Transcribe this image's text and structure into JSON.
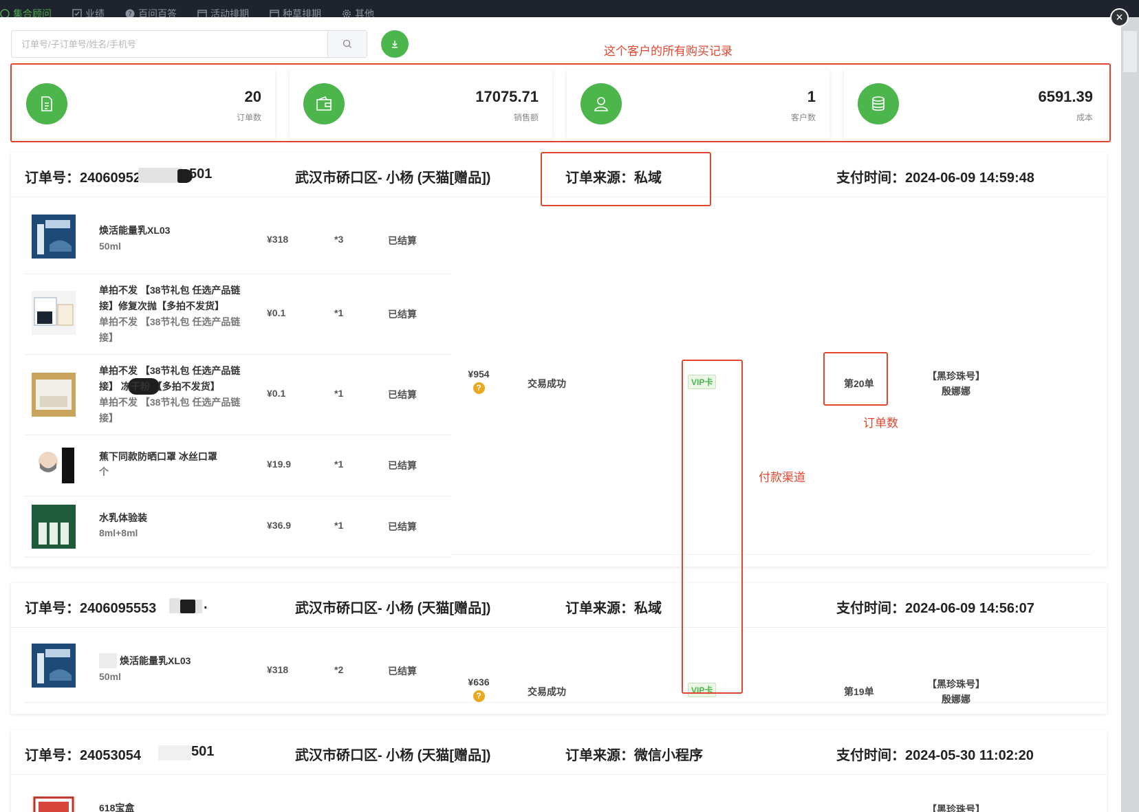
{
  "topnav": {
    "items": [
      {
        "label": "集合顾问",
        "icon": "chat-icon",
        "active": true
      },
      {
        "label": "业绩",
        "icon": "checkbox-icon",
        "active": false
      },
      {
        "label": "百问百答",
        "icon": "question-icon",
        "active": false
      },
      {
        "label": "活动排期",
        "icon": "calendar-icon",
        "active": false
      },
      {
        "label": "种草排期",
        "icon": "calendar-icon",
        "active": false
      },
      {
        "label": "其他",
        "icon": "gear-icon",
        "active": false
      }
    ]
  },
  "search": {
    "placeholder": "订单号/子订单号/姓名/手机号",
    "value": ""
  },
  "annotations": {
    "all_records": "这个客户的所有购买记录",
    "order_count": "订单数",
    "payment_channel": "付款渠道"
  },
  "stats": [
    {
      "value": "20",
      "label": "订单数",
      "icon": "document-icon"
    },
    {
      "value": "17075.71",
      "label": "销售额",
      "icon": "wallet-icon"
    },
    {
      "value": "1",
      "label": "客户数",
      "icon": "user-icon"
    },
    {
      "value": "6591.39",
      "label": "成本",
      "icon": "database-icon"
    }
  ],
  "orders": [
    {
      "order_no": "订单号：24060952",
      "order_no_tail": "501",
      "address": "武汉市硚口区- 小杨 (天猫[赠品])",
      "source": "订单来源：私域",
      "pay_time": "支付时间：2024-06-09 14:59:48",
      "total": "¥954",
      "status": "交易成功",
      "pay_channel": "VIP卡",
      "sequence": "第20单",
      "staff_line1": "【黑珍珠号】",
      "staff_line2": "殷娜娜",
      "items": [
        {
          "name": "焕活能量乳XL03",
          "spec": "50ml",
          "price": "¥318",
          "qty": "*3",
          "settle": "已结算"
        },
        {
          "name": "单拍不发 【38节礼包 任选产品链接】修复次抛【多拍不发货】",
          "spec": "单拍不发 【38节礼包 任选产品链接】",
          "price": "¥0.1",
          "qty": "*1",
          "settle": "已结算"
        },
        {
          "name": "单拍不发 【38节礼包 任选产品链接】 冻干粉 【多拍不发货】",
          "spec": "单拍不发 【38节礼包 任选产品链接】",
          "price": "¥0.1",
          "qty": "*1",
          "settle": "已结算"
        },
        {
          "name": "蕉下同款防晒口罩 冰丝口罩",
          "spec": "个",
          "price": "¥19.9",
          "qty": "*1",
          "settle": "已结算"
        },
        {
          "name": "水乳体验装",
          "spec": "8ml+8ml",
          "price": "¥36.9",
          "qty": "*1",
          "settle": "已结算"
        }
      ]
    },
    {
      "order_no": "订单号：2406095553",
      "order_no_tail": ".",
      "address": "武汉市硚口区- 小杨 (天猫[赠品])",
      "source": "订单来源：私域",
      "pay_time": "支付时间：2024-06-09 14:56:07",
      "total": "¥636",
      "status": "交易成功",
      "pay_channel": "VIP卡",
      "sequence": "第19单",
      "staff_line1": "【黑珍珠号】",
      "staff_line2": "殷娜娜",
      "items": [
        {
          "name": "焕活能量乳XL03",
          "spec": "50ml",
          "price": "¥318",
          "qty": "*2",
          "settle": "已结算"
        }
      ]
    },
    {
      "order_no": "订单号：24053054",
      "order_no_tail": "501",
      "address": "武汉市硚口区- 小杨 (天猫[赠品])",
      "source": "订单来源：微信小程序",
      "pay_time": "支付时间：2024-05-30 11:02:20",
      "items": [
        {
          "name": "618宝盒",
          "spec": "",
          "price": "",
          "qty": "",
          "settle": ""
        }
      ],
      "staff_line1": "【黑珍珠号】"
    }
  ],
  "colors": {
    "accent": "#4cb54c",
    "annotation": "#e0462f",
    "vip_text": "#4cb54c",
    "question_badge": "#e8a820"
  }
}
